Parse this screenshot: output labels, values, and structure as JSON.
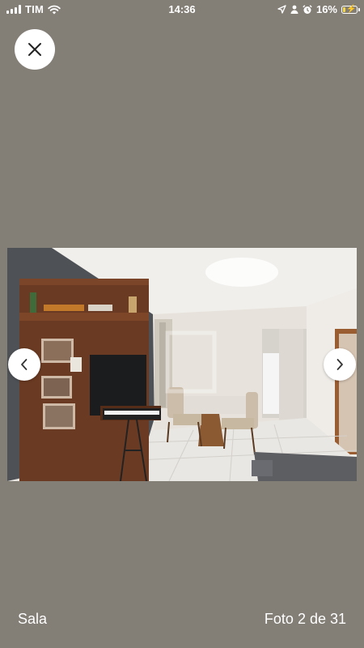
{
  "status_bar": {
    "carrier": "TIM",
    "time": "14:36",
    "battery_percent": "16%",
    "battery_level": 0.16,
    "icons": [
      "signal-icon",
      "wifi-icon",
      "location-icon",
      "person-icon",
      "alarm-icon",
      "battery-icon"
    ]
  },
  "viewer": {
    "close_icon": "close-icon",
    "prev_icon": "chevron-left-icon",
    "next_icon": "chevron-right-icon",
    "caption": "Sala",
    "counter": "Foto 2 de 31",
    "current_photo": 2,
    "total_photos": 31
  },
  "colors": {
    "background": "#837e76",
    "button": "#ffffff",
    "text": "#ffffff"
  }
}
